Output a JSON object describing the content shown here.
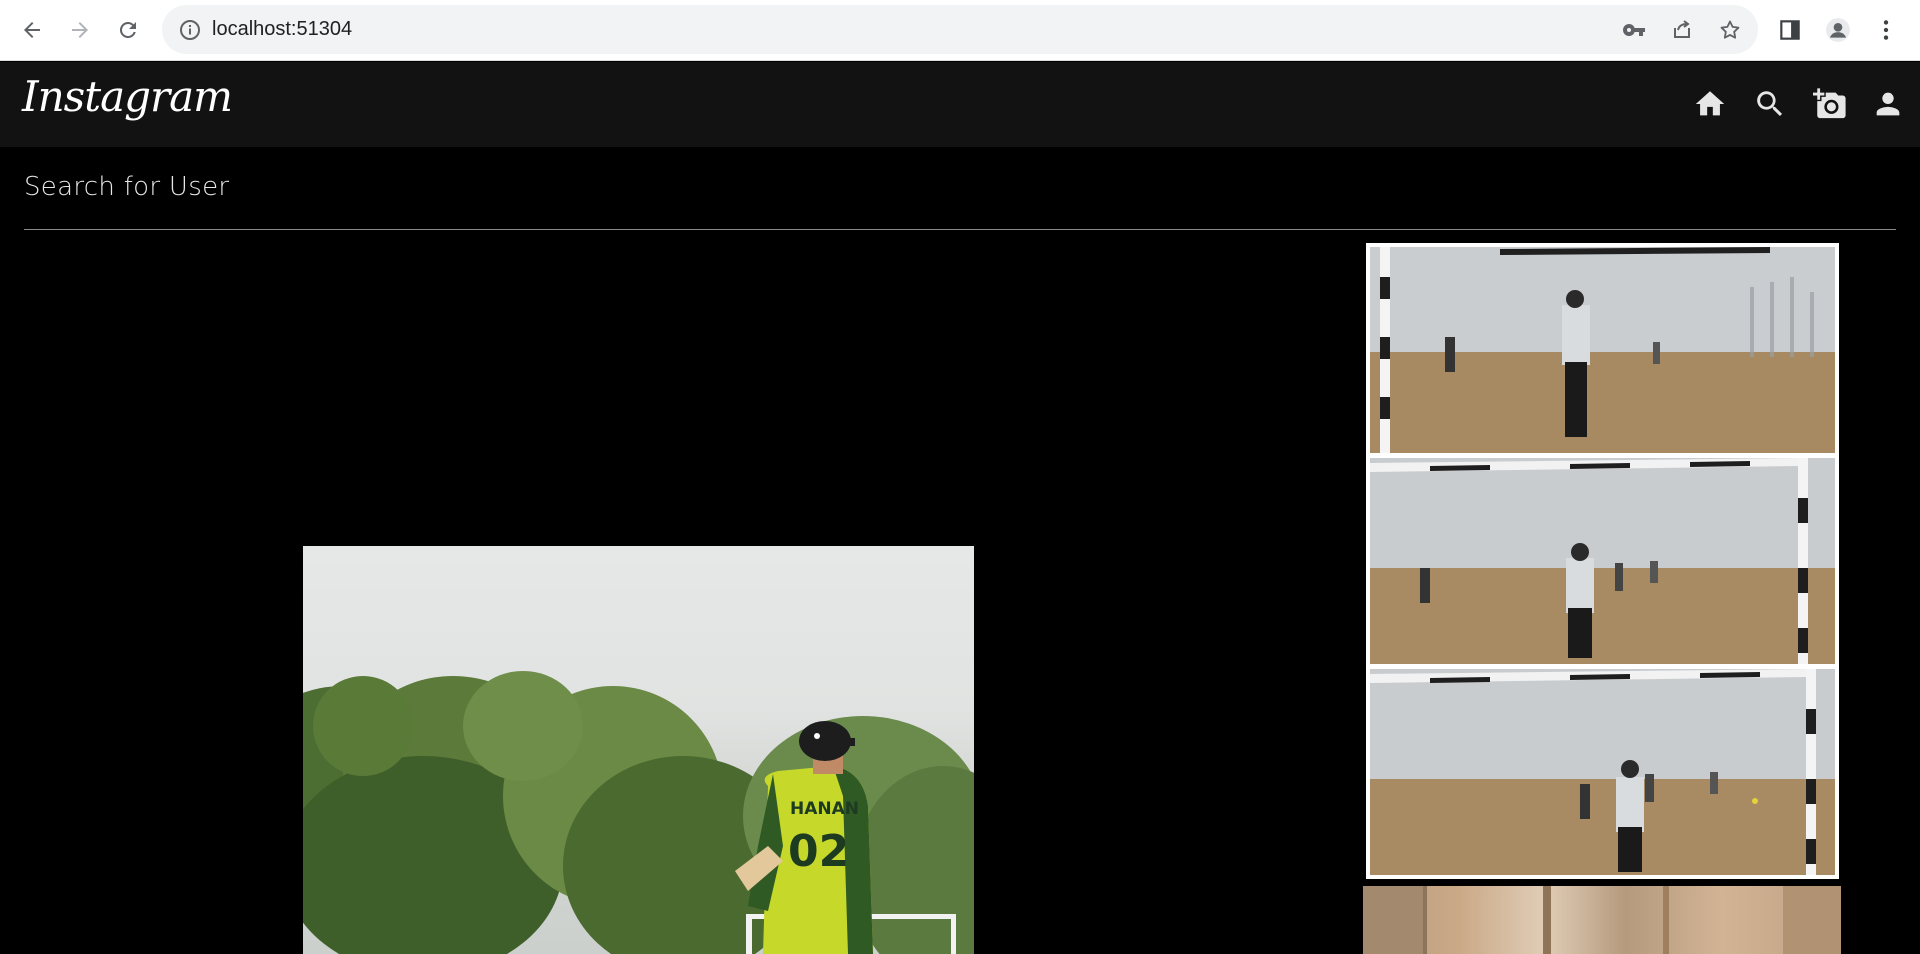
{
  "browser": {
    "url": "localhost:51304",
    "icons": {
      "back": "back-arrow-icon",
      "forward": "forward-arrow-icon",
      "reload": "reload-icon",
      "site_info": "info-icon",
      "password": "key-icon",
      "share": "share-icon",
      "bookmark": "star-icon",
      "side_panel": "side-panel-icon",
      "profile": "profile-icon",
      "menu": "kebab-menu-icon"
    }
  },
  "header": {
    "logo": "Instagram",
    "nav_icons": [
      "home-icon",
      "search-icon",
      "add-photo-icon",
      "account-icon"
    ]
  },
  "search": {
    "label": "Search for User"
  },
  "main_post": {
    "jersey_name": "HANAN",
    "jersey_number": "02"
  },
  "side_posts": {
    "count_visible": 4
  },
  "colors": {
    "page_background": "#000000",
    "header_background": "#121212",
    "browser_toolbar": "#ffffff",
    "omnibox": "#f1f3f4",
    "jersey": "#c6d92a"
  }
}
